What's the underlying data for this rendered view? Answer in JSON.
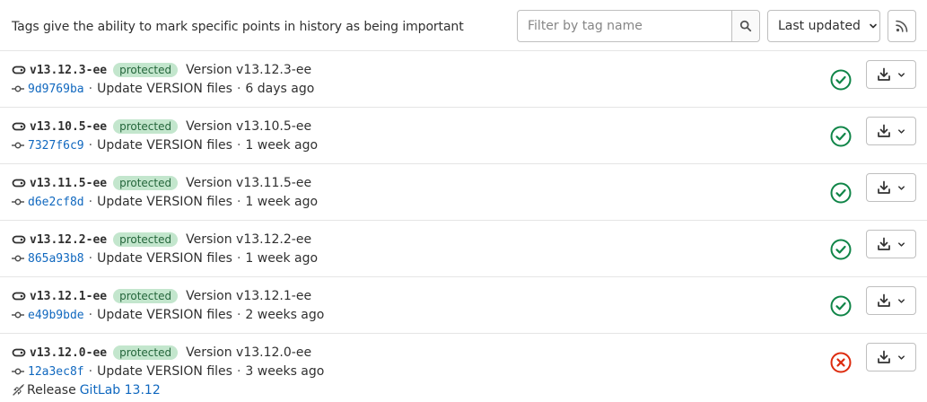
{
  "intro_text": "Tags give the ability to mark specific points in history as being important",
  "filter": {
    "placeholder": "Filter by tag name",
    "value": ""
  },
  "sort": {
    "label": "Last updated"
  },
  "colors": {
    "success": "#108548",
    "failed": "#dd2b0e",
    "link": "#1068bf",
    "badge_bg": "#c3e6cd",
    "badge_text": "#24663b"
  },
  "tags": [
    {
      "name": "v13.12.3-ee",
      "badge": "protected",
      "message": "Version v13.12.3-ee",
      "sha": "9d9769ba",
      "commit_title": "Update VERSION files",
      "time": "6 days ago",
      "status": "success"
    },
    {
      "name": "v13.10.5-ee",
      "badge": "protected",
      "message": "Version v13.10.5-ee",
      "sha": "7327f6c9",
      "commit_title": "Update VERSION files",
      "time": "1 week ago",
      "status": "success"
    },
    {
      "name": "v13.11.5-ee",
      "badge": "protected",
      "message": "Version v13.11.5-ee",
      "sha": "d6e2cf8d",
      "commit_title": "Update VERSION files",
      "time": "1 week ago",
      "status": "success"
    },
    {
      "name": "v13.12.2-ee",
      "badge": "protected",
      "message": "Version v13.12.2-ee",
      "sha": "865a93b8",
      "commit_title": "Update VERSION files",
      "time": "1 week ago",
      "status": "success"
    },
    {
      "name": "v13.12.1-ee",
      "badge": "protected",
      "message": "Version v13.12.1-ee",
      "sha": "e49b9bde",
      "commit_title": "Update VERSION files",
      "time": "2 weeks ago",
      "status": "success"
    },
    {
      "name": "v13.12.0-ee",
      "badge": "protected",
      "message": "Version v13.12.0-ee",
      "sha": "12a3ec8f",
      "commit_title": "Update VERSION files",
      "time": "3 weeks ago",
      "status": "failed",
      "release_prefix": "Release",
      "release_name": "GitLab 13.12"
    }
  ]
}
